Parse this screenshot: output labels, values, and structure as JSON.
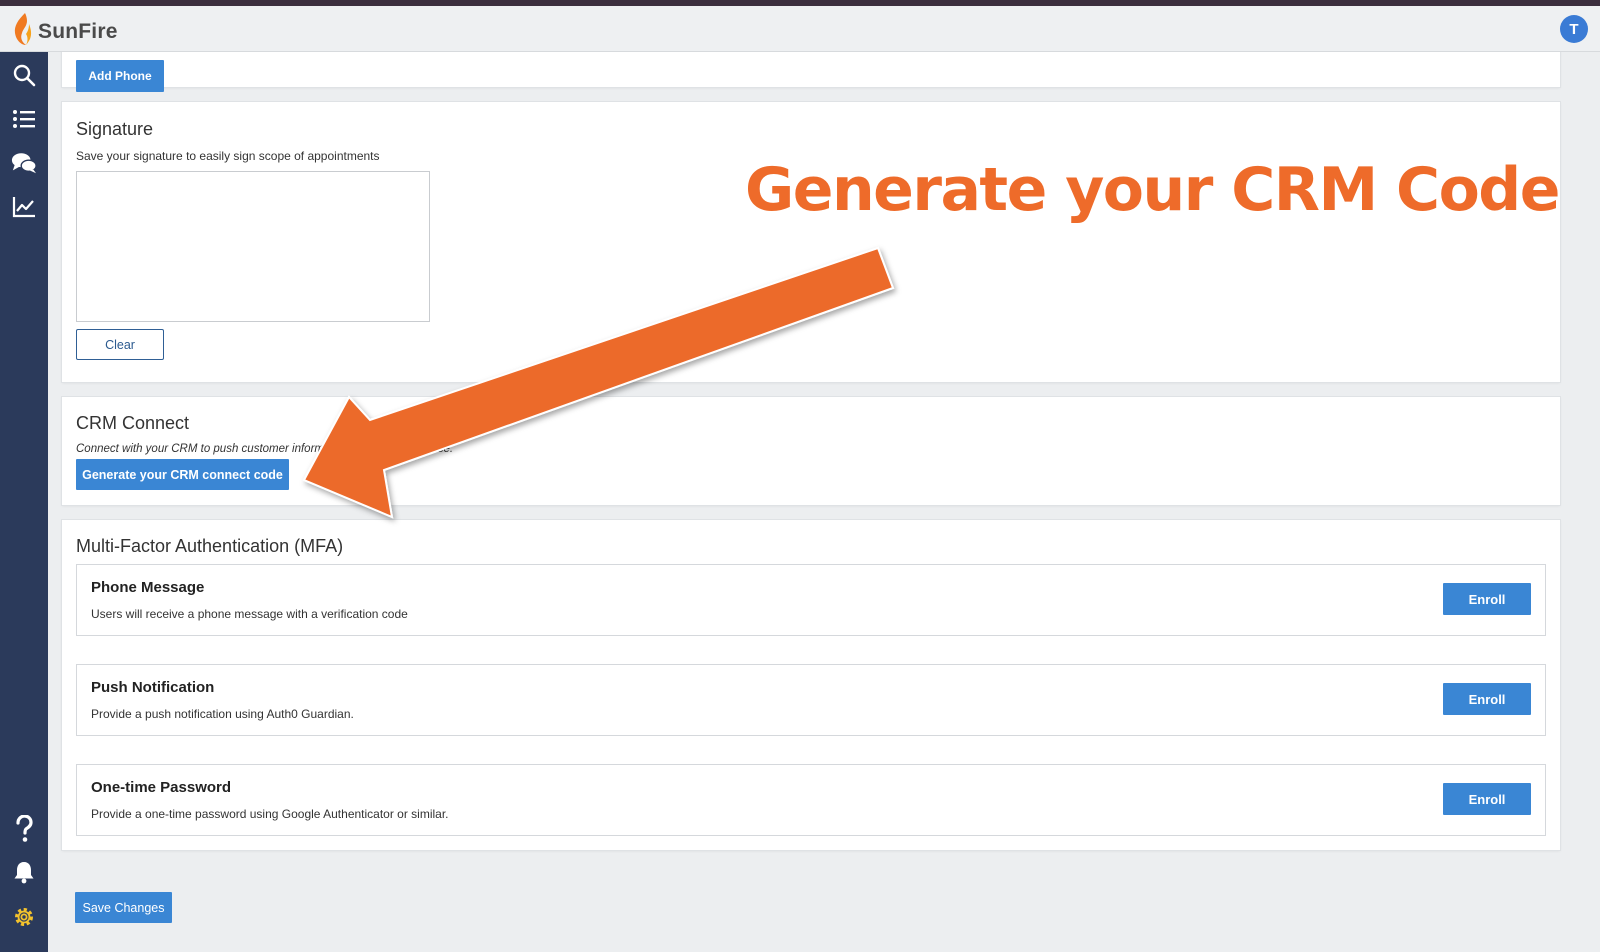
{
  "app": {
    "brand": "SunFire",
    "avatar_initial": "T",
    "brand_color": "#ee6b2a",
    "accent_color": "#3a86d4"
  },
  "sidebar": {
    "items": [
      {
        "icon": "search-icon"
      },
      {
        "icon": "list-icon"
      },
      {
        "icon": "chat-icon"
      },
      {
        "icon": "chart-icon"
      },
      {
        "icon": "help-icon"
      },
      {
        "icon": "bell-icon"
      },
      {
        "icon": "gear-icon"
      }
    ]
  },
  "phone_section": {
    "add_phone_label": "Add Phone"
  },
  "signature": {
    "title": "Signature",
    "description": "Save your signature to easily sign scope of appointments",
    "clear_label": "Clear"
  },
  "crm": {
    "title": "CRM Connect",
    "description": "Connect with your CRM to push customer information for streamlined use.",
    "generate_label": "Generate your CRM connect code"
  },
  "mfa": {
    "title": "Multi-Factor Authentication (MFA)",
    "methods": [
      {
        "title": "Phone Message",
        "description": "Users will receive a phone message with a verification code",
        "button": "Enroll"
      },
      {
        "title": "Push Notification",
        "description": "Provide a push notification using Auth0 Guardian.",
        "button": "Enroll"
      },
      {
        "title": "One-time Password",
        "description": "Provide a one-time password using Google Authenticator or similar.",
        "button": "Enroll"
      }
    ]
  },
  "footer": {
    "save_label": "Save Changes"
  },
  "annotation": {
    "heading": "Generate your CRM Code",
    "color": "#ee6b2a"
  }
}
